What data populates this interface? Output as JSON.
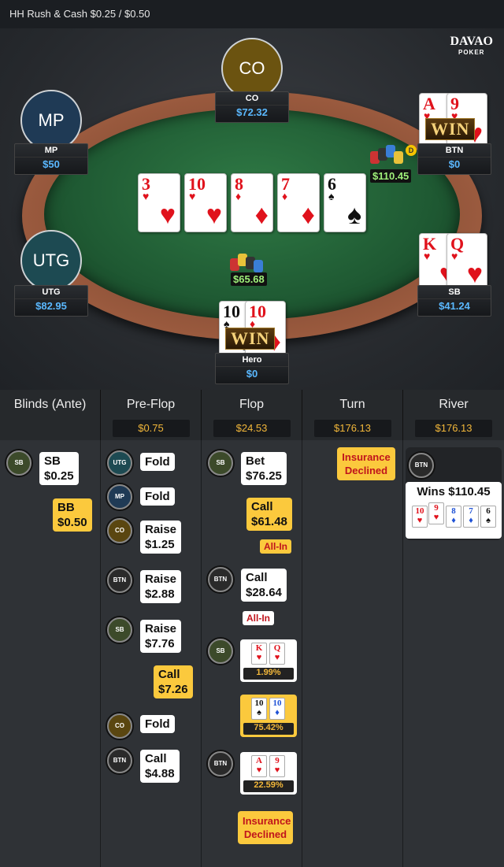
{
  "header": {
    "title": "HH  Rush & Cash $0.25 / $0.50"
  },
  "logo": {
    "text": "DAVAO",
    "sub": "POKER"
  },
  "seats": [
    {
      "pos": "CO",
      "name": "CO",
      "stack": "$72.32",
      "color": "#6b5310"
    },
    {
      "pos": "MP",
      "name": "MP",
      "stack": "$50",
      "color": "#1f3a55"
    },
    {
      "pos": "UTG",
      "name": "UTG",
      "stack": "$82.95",
      "color": "#1d4a52"
    },
    {
      "pos": "",
      "name": "BTN",
      "stack": "$0",
      "color": ""
    },
    {
      "pos": "",
      "name": "SB",
      "stack": "$41.24",
      "color": ""
    },
    {
      "pos": "",
      "name": "Hero",
      "stack": "$0",
      "color": ""
    }
  ],
  "board": [
    {
      "rank": "3",
      "suit": "♥",
      "color": "red"
    },
    {
      "rank": "10",
      "suit": "♥",
      "color": "red"
    },
    {
      "rank": "8",
      "suit": "♦",
      "color": "red"
    },
    {
      "rank": "7",
      "suit": "♦",
      "color": "red"
    },
    {
      "rank": "6",
      "suit": "♠",
      "color": "blk"
    }
  ],
  "hands": {
    "btn": [
      {
        "rank": "A",
        "suit": "♥",
        "color": "red"
      },
      {
        "rank": "9",
        "suit": "♥",
        "color": "red"
      }
    ],
    "sb": [
      {
        "rank": "K",
        "suit": "♥",
        "color": "red"
      },
      {
        "rank": "Q",
        "suit": "♥",
        "color": "red"
      }
    ],
    "hero": [
      {
        "rank": "10",
        "suit": "♠",
        "color": "blk"
      },
      {
        "rank": "10",
        "suit": "♦",
        "color": "red"
      }
    ]
  },
  "win_label": "WIN",
  "dealer_button": "D",
  "pots": {
    "side": "$110.45",
    "main": "$65.68"
  },
  "history": {
    "columns": [
      {
        "title": "Blinds (Ante)",
        "pot": ""
      },
      {
        "title": "Pre-Flop",
        "pot": "$0.75"
      },
      {
        "title": "Flop",
        "pot": "$24.53"
      },
      {
        "title": "Turn",
        "pot": "$176.13"
      },
      {
        "title": "River",
        "pot": "$176.13"
      }
    ],
    "blinds": {
      "sb_chip": "SB",
      "sb_action": "SB",
      "sb_amt": "$0.25",
      "bb_action": "BB",
      "bb_amt": "$0.50"
    },
    "preflop": [
      {
        "chip": "UTG",
        "act": "Fold",
        "amt": ""
      },
      {
        "chip": "MP",
        "act": "Fold",
        "amt": ""
      },
      {
        "chip": "CO",
        "act": "Raise",
        "amt": "$1.25"
      },
      {
        "chip": "BTN",
        "act": "Raise",
        "amt": "$2.88"
      },
      {
        "chip": "SB",
        "act": "Raise",
        "amt": "$7.76"
      },
      {
        "chip": "",
        "act": "Call",
        "amt": "$7.26"
      },
      {
        "chip": "CO",
        "act": "Fold",
        "amt": ""
      },
      {
        "chip": "BTN",
        "act": "Call",
        "amt": "$4.88"
      }
    ],
    "flop": {
      "sb_chip": "SB",
      "sb_act": "Bet",
      "sb_amt": "$76.25",
      "hero_act": "Call",
      "hero_amt": "$61.48",
      "allin1": "All-In",
      "btn_chip": "BTN",
      "btn_act": "Call",
      "btn_amt": "$28.64",
      "allin2": "All-In",
      "eq_sb_chip": "SB",
      "eq_sb_cards": [
        {
          "rank": "K",
          "suit": "♥",
          "color": "red"
        },
        {
          "rank": "Q",
          "suit": "♥",
          "color": "red"
        }
      ],
      "eq_sb": "1.99%",
      "eq_hero_cards": [
        {
          "rank": "10",
          "suit": "♠",
          "color": "blk"
        },
        {
          "rank": "10",
          "suit": "♦",
          "color": "blu"
        }
      ],
      "eq_hero": "75.42%",
      "eq_btn_chip": "BTN",
      "eq_btn_cards": [
        {
          "rank": "A",
          "suit": "♥",
          "color": "red"
        },
        {
          "rank": "9",
          "suit": "♥",
          "color": "red"
        }
      ],
      "eq_btn": "22.59%",
      "insurance": "Insurance Declined"
    },
    "turn": {
      "insurance": "Insurance Declined"
    },
    "river": {
      "chip": "BTN",
      "wins": "Wins $110.45",
      "cards": [
        {
          "rank": "10",
          "suit": "♥",
          "color": "red"
        },
        {
          "rank": "9",
          "suit": "♥",
          "color": "red"
        },
        {
          "rank": "8",
          "suit": "♦",
          "color": "blu"
        },
        {
          "rank": "7",
          "suit": "♦",
          "color": "blu"
        },
        {
          "rank": "6",
          "suit": "♠",
          "color": "blk"
        }
      ]
    }
  }
}
